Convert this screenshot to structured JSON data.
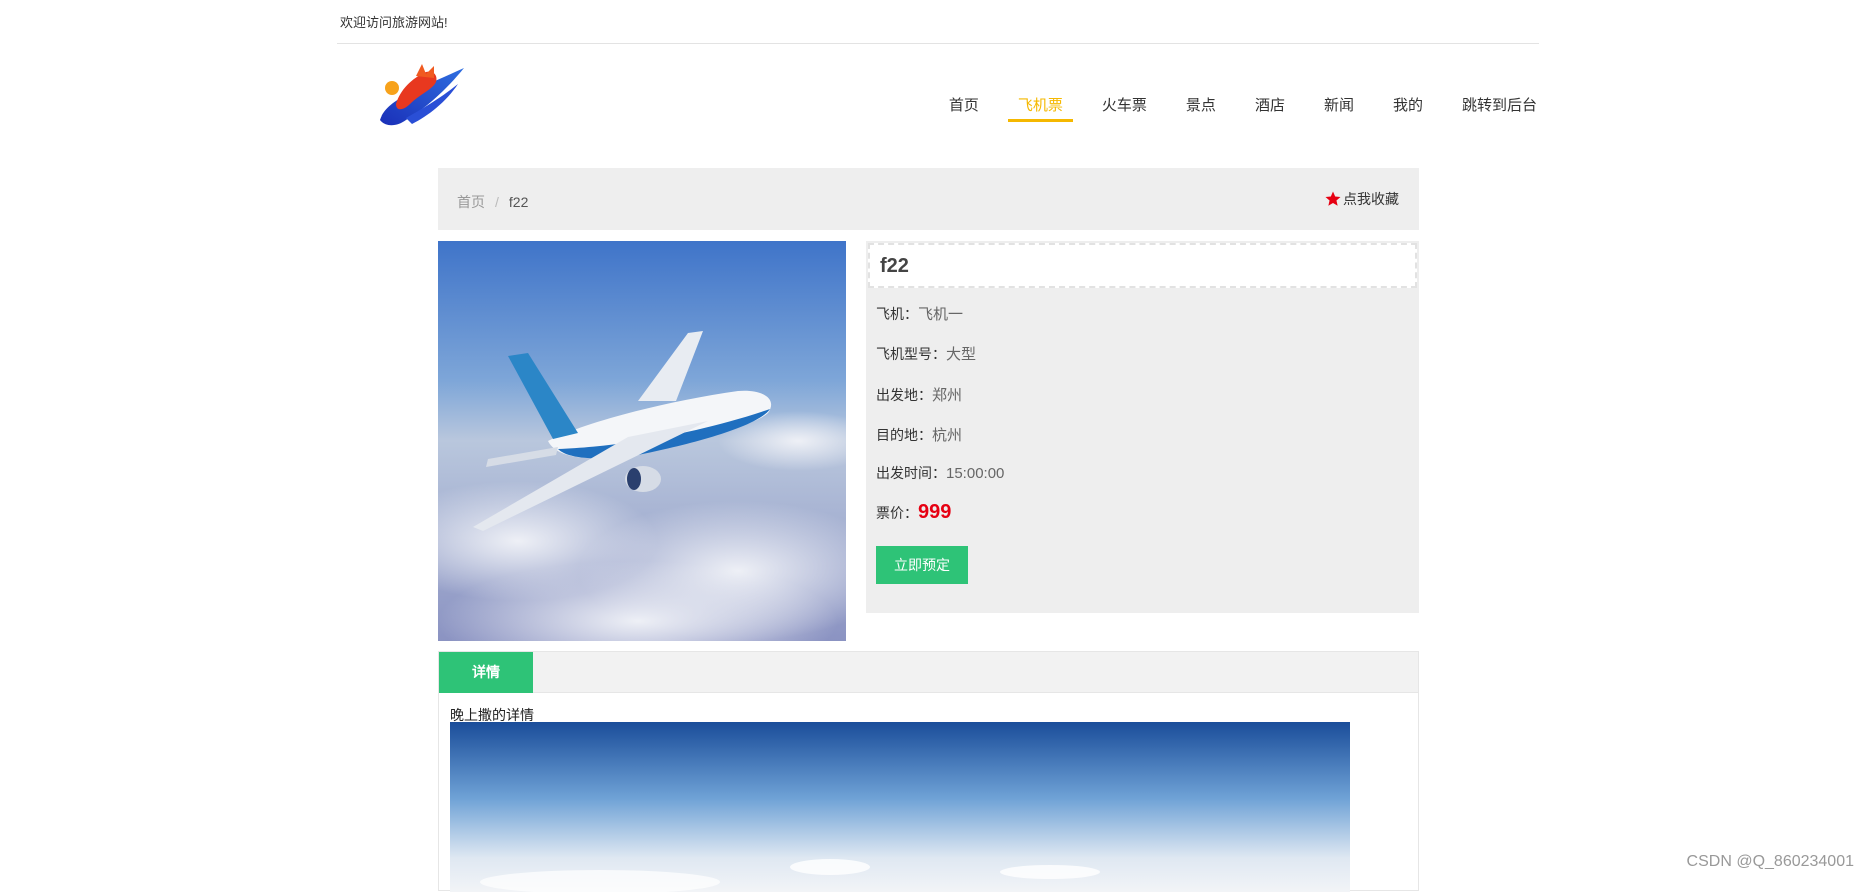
{
  "topbar": {
    "welcome": "欢迎访问旅游网站!"
  },
  "header": {
    "nav": [
      {
        "label": "首页",
        "active": false
      },
      {
        "label": "飞机票",
        "active": true
      },
      {
        "label": "火车票",
        "active": false
      },
      {
        "label": "景点",
        "active": false
      },
      {
        "label": "酒店",
        "active": false
      },
      {
        "label": "新闻",
        "active": false
      },
      {
        "label": "我的",
        "active": false
      },
      {
        "label": "跳转到后台",
        "active": false
      }
    ]
  },
  "breadcrumb": {
    "home": "首页",
    "separator": "/",
    "current": "f22"
  },
  "favorite": {
    "label": "点我收藏",
    "icon": "star-icon"
  },
  "product": {
    "title": "f22",
    "fields": [
      {
        "label": "飞机：",
        "value": "飞机一"
      },
      {
        "label": "飞机型号：",
        "value": "大型"
      },
      {
        "label": "出发地：",
        "value": "郑州"
      },
      {
        "label": "目的地：",
        "value": "杭州"
      },
      {
        "label": "出发时间：",
        "value": "15:00:00"
      }
    ],
    "price_label": "票价：",
    "price": "999",
    "book_button": "立即预定"
  },
  "detail": {
    "tab": "详情",
    "text": "晚上撒的详情"
  },
  "watermark": "CSDN @Q_860234001",
  "colors": {
    "accent": "#2ec377",
    "nav_active": "#f5b800",
    "price": "#e60012"
  }
}
